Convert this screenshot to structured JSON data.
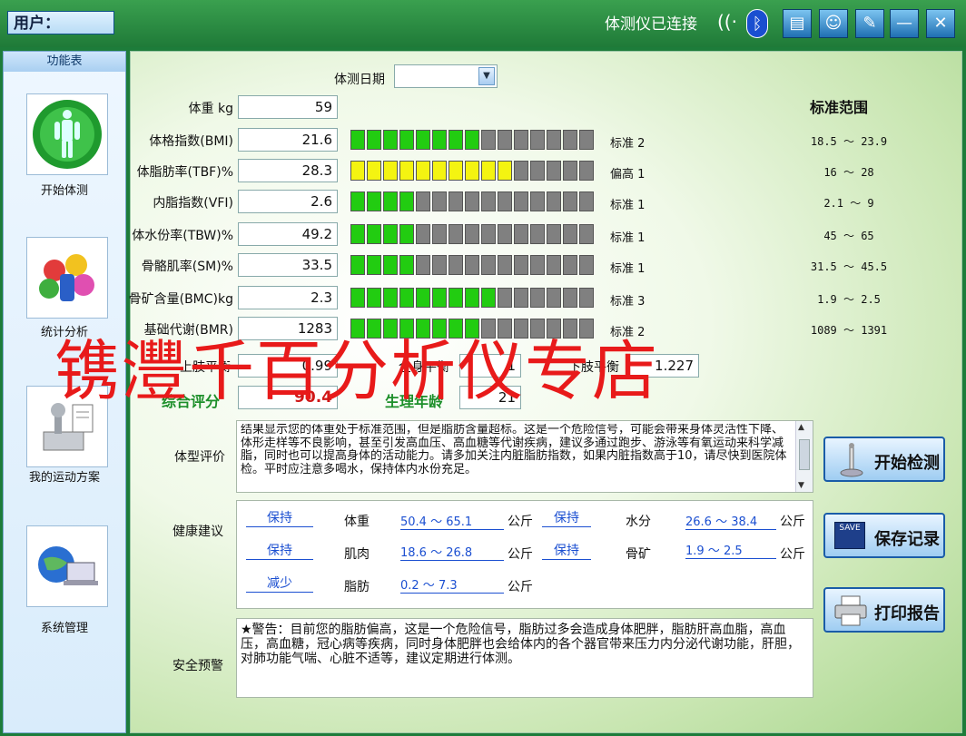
{
  "header": {
    "user_label": "用户：",
    "connection_status": "体测仪已连接",
    "colors": {
      "bar": "#22883f",
      "accent": "#1f6fb3"
    }
  },
  "sidebar": {
    "title": "功能表",
    "items": [
      {
        "label": "开始体测",
        "icon": "body-icon"
      },
      {
        "label": "统计分析",
        "icon": "pills-icon"
      },
      {
        "label": "我的运动方案",
        "icon": "tools-icon"
      },
      {
        "label": "系统管理",
        "icon": "globe-laptop-icon"
      }
    ]
  },
  "measure": {
    "date_label": "体测日期",
    "range_header": "标准范围",
    "metrics": [
      {
        "label": "体重 kg",
        "value": "59",
        "status": "",
        "range": ""
      },
      {
        "label": "体格指数(BMI)",
        "value": "21.6",
        "status": "标准 2",
        "range": "18.5 ～ 23.9",
        "green": 8,
        "yellow": 0
      },
      {
        "label": "体脂肪率(TBF)%",
        "value": "28.3",
        "status": "偏高 1",
        "range": "16 ～ 28",
        "green": 0,
        "yellow": 10
      },
      {
        "label": "内脂指数(VFI)",
        "value": "2.6",
        "status": "标准 1",
        "range": "2.1 ～ 9",
        "green": 4,
        "yellow": 0
      },
      {
        "label": "体水份率(TBW)%",
        "value": "49.2",
        "status": "标准 1",
        "range": "45 ～ 65",
        "green": 4,
        "yellow": 0
      },
      {
        "label": "骨骼肌率(SM)%",
        "value": "33.5",
        "status": "标准 1",
        "range": "31.5 ～ 45.5",
        "green": 4,
        "yellow": 0
      },
      {
        "label": "骨矿含量(BMC)kg",
        "value": "2.3",
        "status": "标准 3",
        "range": "1.9 ～ 2.5",
        "green": 9,
        "yellow": 0
      },
      {
        "label": "基础代谢(BMR)",
        "value": "1283",
        "status": "标准 2",
        "range": "1089 ～ 1391",
        "green": 8,
        "yellow": 0
      }
    ],
    "segments_total": 15,
    "balance": {
      "upper_label": "上肢平衡",
      "upper_value": "0.99",
      "whole_label": "全身平衡",
      "whole_value": "1",
      "lower_label": "下肢平衡",
      "lower_value": "1.227"
    },
    "score_label": "综合评分",
    "score_value": "90.4",
    "age_label": "生理年龄",
    "age_value": "21"
  },
  "evaluation": {
    "label": "体型评价",
    "text": "结果显示您的体重处于标准范围，但是脂肪含量超标。这是一个危险信号，可能会带来身体灵活性下降、体形走样等不良影响，甚至引发高血压、高血糖等代谢疾病，建议多通过跑步、游泳等有氧运动来科学减脂，同时也可以提高身体的活动能力。请多加关注内脏脂肪指数，如果内脏指数高于10，请尽快到医院体检。平时应注意多喝水，保持体内水份充足。"
  },
  "advice": {
    "label": "健康建议",
    "unit": "公斤",
    "rows": [
      {
        "action": "保持",
        "name": "体重",
        "range": "50.4 ～ 65.1",
        "action2": "保持",
        "name2": "水分",
        "range2": "26.6 ～ 38.4"
      },
      {
        "action": "保持",
        "name": "肌肉",
        "range": "18.6 ～ 26.8",
        "action2": "保持",
        "name2": "骨矿",
        "range2": "1.9 ～ 2.5"
      },
      {
        "action": "减少",
        "name": "脂肪",
        "range": "0.2 ～ 7.3"
      }
    ]
  },
  "warning": {
    "label": "安全预警",
    "text": "★警告：目前您的脂肪偏高，这是一个危险信号，脂肪过多会造成身体肥胖，脂肪肝高血脂，高血压，高血糖，冠心病等疾病，同时身体肥胖也会给体内的各个器官带来压力内分泌代谢功能，肝胆，对肺功能气喘、心脏不适等，建议定期进行体测。"
  },
  "actions": {
    "start": "开始检测",
    "save": "保存记录",
    "save_icon_text": "SAVE",
    "print": "打印报告"
  },
  "watermark": "镌灃千百分析仪专店"
}
